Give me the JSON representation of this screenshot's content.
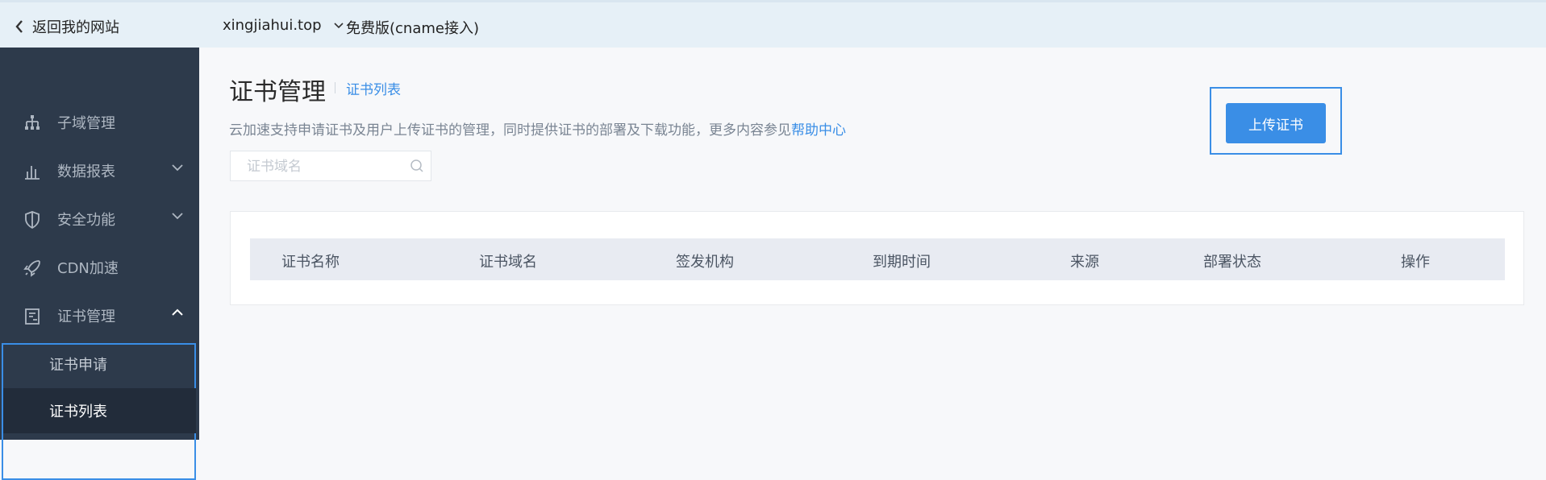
{
  "topbar": {
    "back_label": "返回我的网站",
    "domain": "xingjiahui.top",
    "plan": "免费版(cname接入)"
  },
  "sidebar": {
    "items": [
      {
        "label": "子域管理",
        "icon": "sitemap-icon"
      },
      {
        "label": "数据报表",
        "icon": "bar-chart-icon",
        "expandable": true
      },
      {
        "label": "安全功能",
        "icon": "shield-icon",
        "expandable": true
      },
      {
        "label": "CDN加速",
        "icon": "rocket-icon"
      },
      {
        "label": "证书管理",
        "icon": "certificate-icon",
        "expanded": true,
        "children": [
          {
            "label": "证书申请"
          },
          {
            "label": "证书列表",
            "active": true
          }
        ]
      }
    ]
  },
  "main": {
    "title": "证书管理",
    "subtitle": "证书列表",
    "description": "云加速支持申请证书及用户上传证书的管理，同时提供证书的部署及下载功能，更多内容参见",
    "help_link": "帮助中心",
    "search_placeholder": "证书域名",
    "upload_button": "上传证书",
    "table_headers": [
      "证书名称",
      "证书域名",
      "签发机构",
      "到期时间",
      "来源",
      "部署状态",
      "操作"
    ]
  },
  "colors": {
    "accent": "#3a8ee6",
    "sidebar_bg": "#2d3a4b",
    "topbar_bg": "#e6f0f7"
  }
}
